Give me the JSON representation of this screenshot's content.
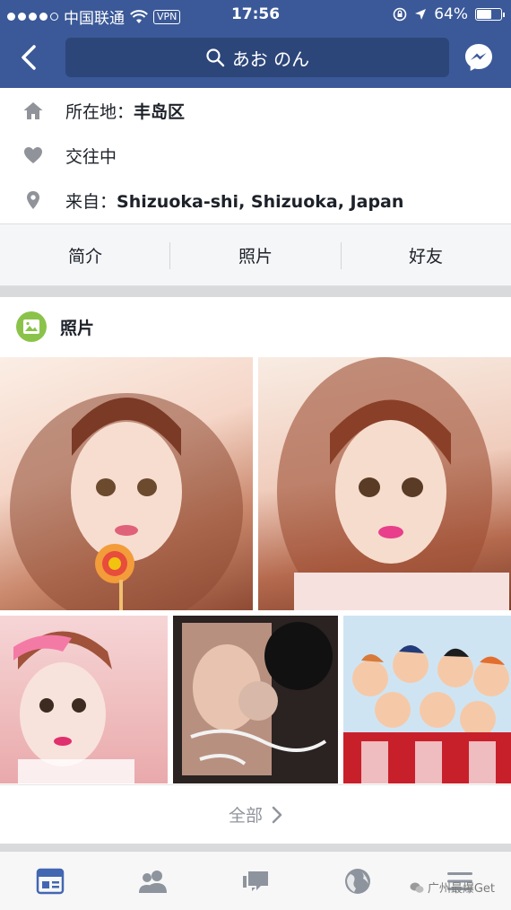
{
  "status_bar": {
    "carrier": "中国联通",
    "vpn": "VPN",
    "time": "17:56",
    "battery": "64%",
    "battery_level": 0.64
  },
  "header": {
    "search_text": "あお のん",
    "accent": "#3b5998"
  },
  "info": {
    "location_label": "所在地：",
    "location_value": "丰岛区",
    "relationship": "交往中",
    "from_label": "来自：",
    "from_value": "Shizuoka-shi, Shizuoka, Japan"
  },
  "tabs": [
    "简介",
    "照片",
    "好友"
  ],
  "photos": {
    "title": "照片",
    "see_all": "全部"
  },
  "bottom_nav": {
    "items": [
      "news-feed-icon",
      "friends-icon",
      "messages-icon",
      "globe-icon",
      "menu-icon"
    ]
  },
  "watermark": "广州最爆Get"
}
